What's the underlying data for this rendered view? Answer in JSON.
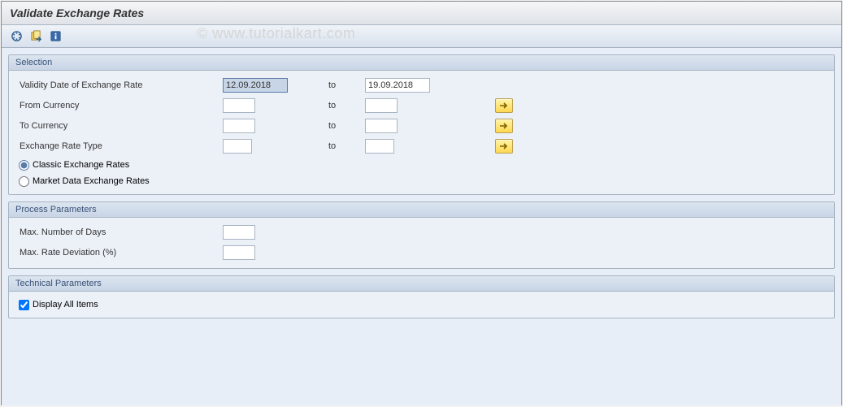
{
  "title": "Validate Exchange Rates",
  "watermark": "© www.tutorialkart.com",
  "icons": {
    "execute": "execute-icon",
    "variants": "get-variant-icon",
    "info": "info-icon"
  },
  "selection": {
    "title": "Selection",
    "validity_date_label": "Validity Date of Exchange Rate",
    "validity_date_from": "12.09.2018",
    "validity_date_to_label": "to",
    "validity_date_to": "19.09.2018",
    "from_currency_label": "From Currency",
    "from_currency_from": "",
    "from_currency_to_label": "to",
    "from_currency_to": "",
    "to_currency_label": "To Currency",
    "to_currency_from": "",
    "to_currency_to_label": "to",
    "to_currency_to": "",
    "exchange_rate_type_label": "Exchange Rate Type",
    "exchange_rate_type_from": "",
    "exchange_rate_type_to_label": "to",
    "exchange_rate_type_to": "",
    "radio_classic": "Classic Exchange Rates",
    "radio_market": "Market Data Exchange Rates",
    "radio_selected": "classic"
  },
  "process": {
    "title": "Process Parameters",
    "max_days_label": "Max. Number of Days",
    "max_days_value": "",
    "max_deviation_label": "Max. Rate Deviation (%)",
    "max_deviation_value": ""
  },
  "technical": {
    "title": "Technical Parameters",
    "display_all_label": "Display All Items",
    "display_all_checked": true
  }
}
